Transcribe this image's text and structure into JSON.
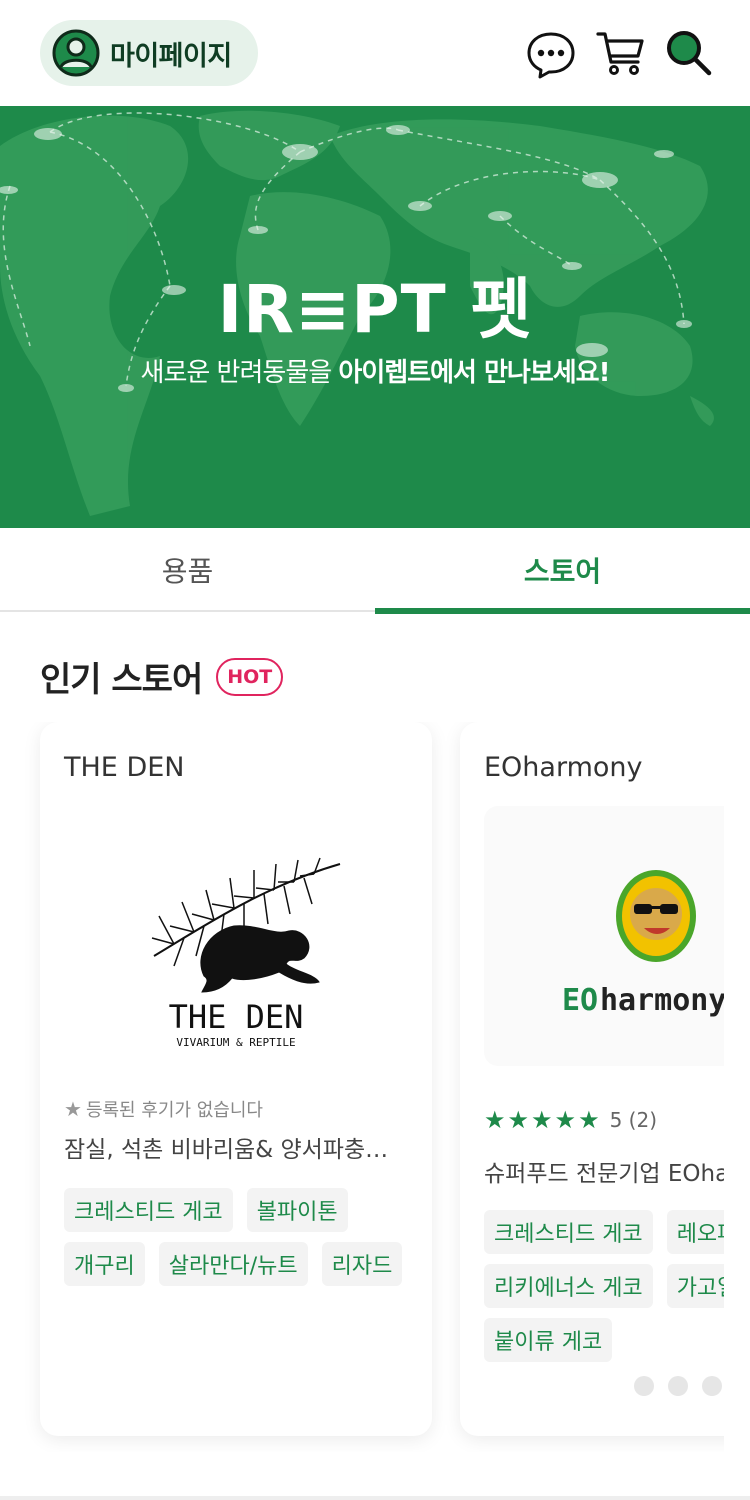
{
  "header": {
    "mypage_label": "마이페이지",
    "icons": [
      "user-icon",
      "chat-icon",
      "cart-icon",
      "search-icon"
    ]
  },
  "banner": {
    "logo": "IR≡PT 펫",
    "subtitle_plain": "새로운 반려동물을 ",
    "subtitle_bold": "아이렙트에서 만나보세요!",
    "background_color": "#1e8a4a"
  },
  "tabs": [
    {
      "label": "용품",
      "active": false
    },
    {
      "label": "스토어",
      "active": true
    }
  ],
  "section": {
    "title": "인기 스토어",
    "badge": "HOT"
  },
  "stores": [
    {
      "name": "THE DEN",
      "logo_text": "THE DEN",
      "logo_subtext": "VIVARIUM & REPTILE",
      "rating_text": "등록된 후기가 없습니다",
      "description": "잠실, 석촌 비바리움& 양서파충류 전문샵",
      "tags": [
        "크레스티드 게코",
        "볼파이톤",
        "개구리",
        "살라만다/뉴트",
        "리자드"
      ]
    },
    {
      "name": "EOharmony",
      "logo_text_green": "EO",
      "logo_text_lime": "",
      "logo_text_dark": "harmony",
      "rating": "5",
      "rating_count": "(2)",
      "description": "슈퍼푸드 전문기업 EOharmony",
      "tags": [
        "크레스티드 게코",
        "레오파드 게코",
        "리키에너스 게코",
        "가고일 게코",
        "붙이류 게코"
      ]
    }
  ],
  "colors": {
    "accent": "#1e8a4a",
    "hot_badge": "#e0245e",
    "tag_bg": "#f3f3f3"
  }
}
